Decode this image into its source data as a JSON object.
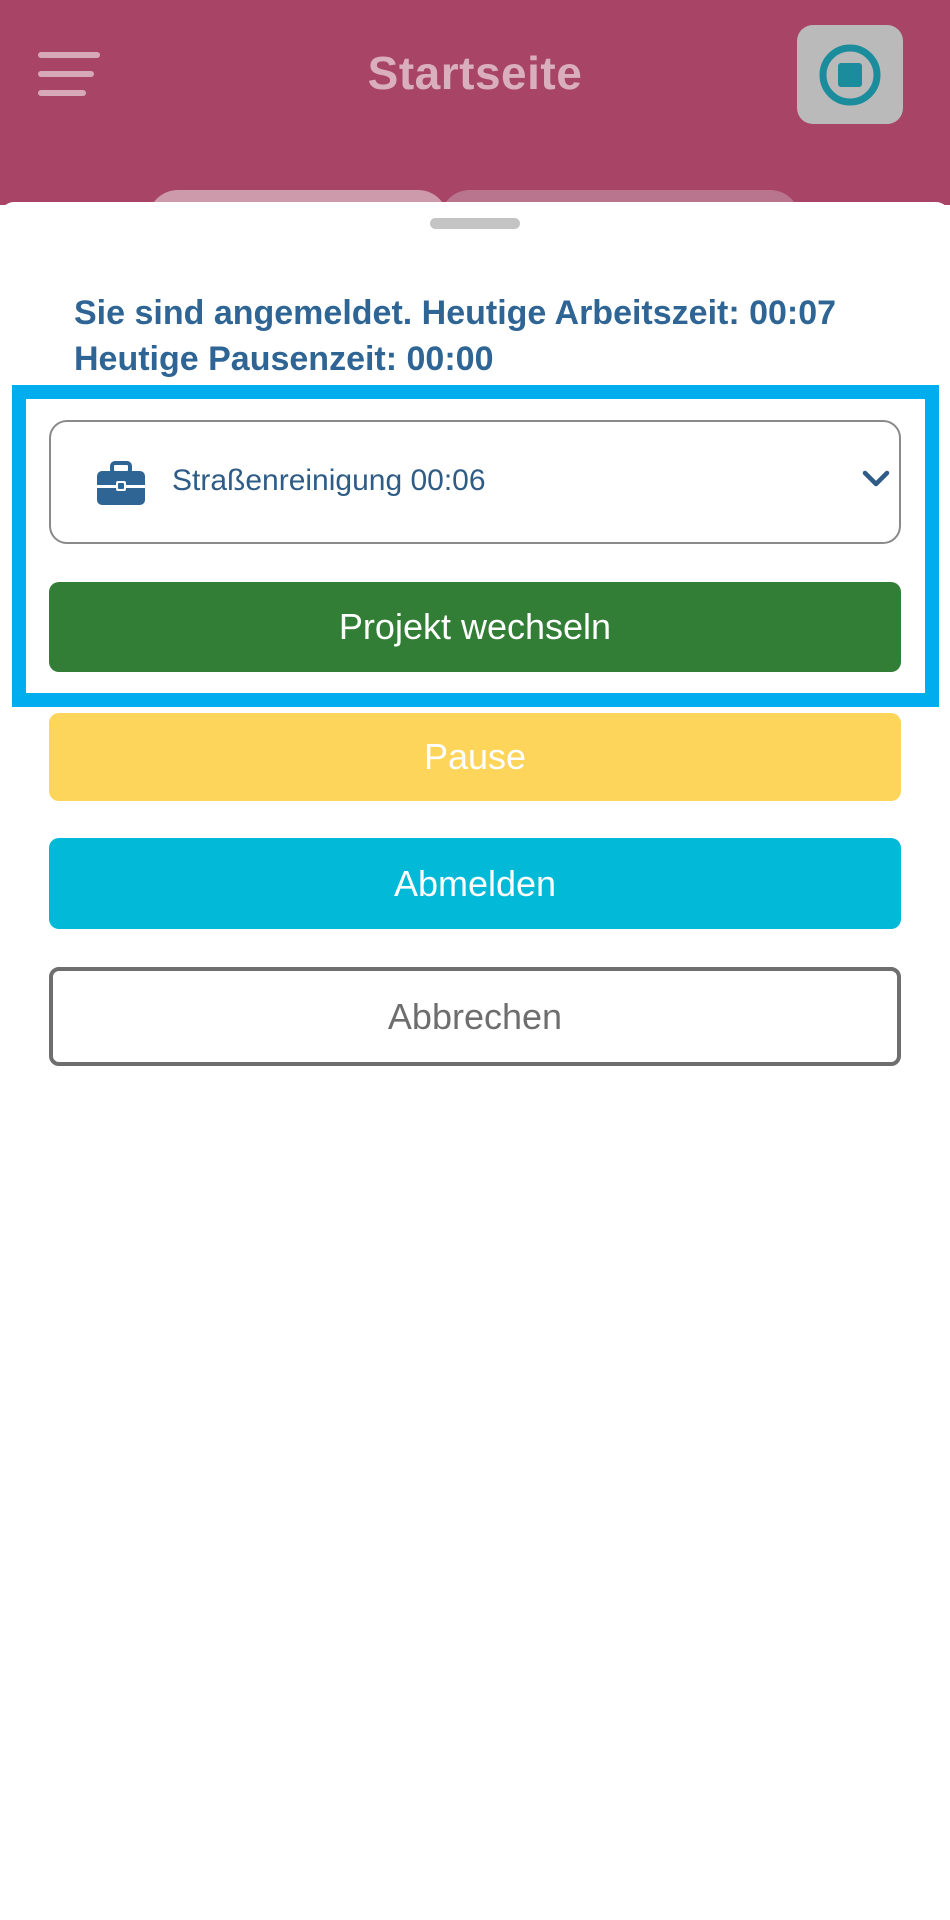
{
  "header": {
    "title": "Startseite",
    "menu_icon": "hamburger-menu-icon",
    "stop_icon": "stop-circle-icon",
    "colors": {
      "background": "#A84566",
      "stop_accent": "#1A8C9C"
    }
  },
  "status": {
    "text": "Sie sind angemeldet. Heutige Arbeitszeit: 00:07 Heutige Pausenzeit: 00:00"
  },
  "project_select": {
    "icon": "briefcase-icon",
    "selected": "Straßenreinigung 00:06",
    "chevron_icon": "chevron-down-icon"
  },
  "actions": {
    "switch_label": "Projekt wechseln",
    "pause_label": "Pause",
    "logout_label": "Abmelden",
    "cancel_label": "Abbrechen"
  },
  "colors": {
    "switch": "#327E36",
    "pause": "#FDD55A",
    "logout": "#02BAD7",
    "highlight": "#00AEEF",
    "text_accent": "#2F6594"
  }
}
